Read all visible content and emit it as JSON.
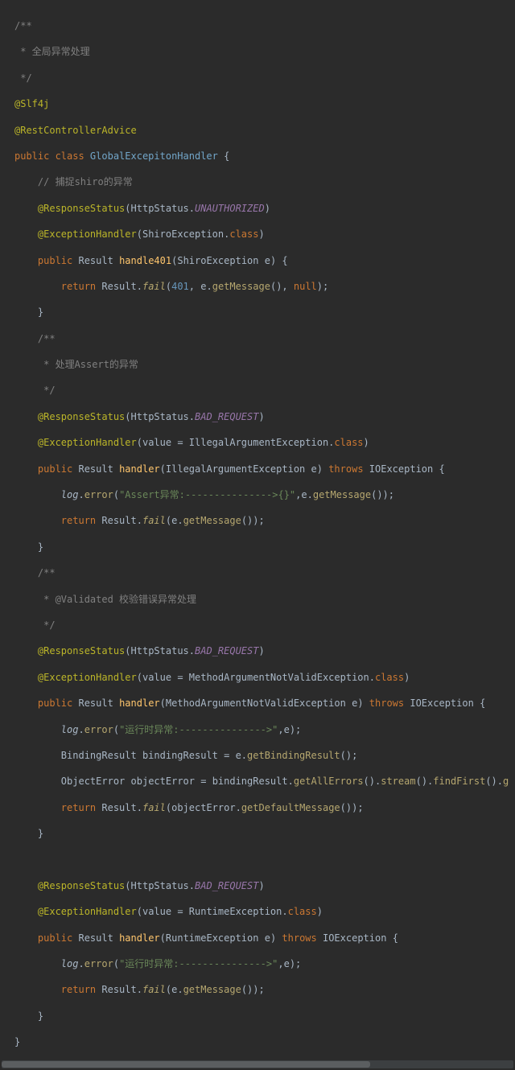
{
  "lines": [
    [
      {
        "cls": "c-comment",
        "t": "/**"
      }
    ],
    [
      {
        "cls": "c-comment",
        "t": " * 全局异常处理"
      }
    ],
    [
      {
        "cls": "c-comment",
        "t": " */"
      }
    ],
    [
      {
        "cls": "c-annotation",
        "t": "@Slf4j"
      }
    ],
    [
      {
        "cls": "c-annotation",
        "t": "@RestControllerAdvice"
      }
    ],
    [
      {
        "cls": "c-keyword",
        "t": "public class "
      },
      {
        "cls": "c-classname",
        "t": "GlobalExcepitonHandler"
      },
      {
        "cls": "c-punct",
        "t": " {"
      }
    ],
    [
      {
        "cls": "",
        "t": "    "
      },
      {
        "cls": "c-comment",
        "t": "// 捕捉shiro的异常"
      }
    ],
    [
      {
        "cls": "",
        "t": "    "
      },
      {
        "cls": "c-annotation",
        "t": "@ResponseStatus"
      },
      {
        "cls": "c-punct",
        "t": "("
      },
      {
        "cls": "c-classuse",
        "t": "HttpStatus"
      },
      {
        "cls": "c-punct",
        "t": "."
      },
      {
        "cls": "c-const",
        "t": "UNAUTHORIZED"
      },
      {
        "cls": "c-punct",
        "t": ")"
      }
    ],
    [
      {
        "cls": "",
        "t": "    "
      },
      {
        "cls": "c-annotation",
        "t": "@ExceptionHandler"
      },
      {
        "cls": "c-punct",
        "t": "("
      },
      {
        "cls": "c-classuse",
        "t": "ShiroException"
      },
      {
        "cls": "c-punct",
        "t": "."
      },
      {
        "cls": "c-keyword",
        "t": "class"
      },
      {
        "cls": "c-punct",
        "t": ")"
      }
    ],
    [
      {
        "cls": "",
        "t": "    "
      },
      {
        "cls": "c-keyword",
        "t": "public "
      },
      {
        "cls": "c-classuse",
        "t": "Result"
      },
      {
        "cls": "",
        "t": " "
      },
      {
        "cls": "c-method",
        "t": "handle401"
      },
      {
        "cls": "c-punct",
        "t": "("
      },
      {
        "cls": "c-classuse",
        "t": "ShiroException"
      },
      {
        "cls": "",
        "t": " "
      },
      {
        "cls": "c-param",
        "t": "e"
      },
      {
        "cls": "c-punct",
        "t": ") {"
      }
    ],
    [
      {
        "cls": "",
        "t": "        "
      },
      {
        "cls": "c-keyword",
        "t": "return "
      },
      {
        "cls": "c-classuse",
        "t": "Result"
      },
      {
        "cls": "c-punct",
        "t": "."
      },
      {
        "cls": "c-methoduse c-static",
        "t": "fail"
      },
      {
        "cls": "c-punct",
        "t": "("
      },
      {
        "cls": "c-number",
        "t": "401"
      },
      {
        "cls": "c-punct",
        "t": ", "
      },
      {
        "cls": "c-var",
        "t": "e"
      },
      {
        "cls": "c-punct",
        "t": "."
      },
      {
        "cls": "c-methoduse",
        "t": "getMessage"
      },
      {
        "cls": "c-punct",
        "t": "(), "
      },
      {
        "cls": "c-keyword",
        "t": "null"
      },
      {
        "cls": "c-punct",
        "t": ");"
      }
    ],
    [
      {
        "cls": "",
        "t": "    "
      },
      {
        "cls": "c-punct",
        "t": "}"
      }
    ],
    [
      {
        "cls": "",
        "t": "    "
      },
      {
        "cls": "c-comment",
        "t": "/**"
      }
    ],
    [
      {
        "cls": "",
        "t": "     "
      },
      {
        "cls": "c-comment",
        "t": "* 处理Assert的异常"
      }
    ],
    [
      {
        "cls": "",
        "t": "     "
      },
      {
        "cls": "c-comment",
        "t": "*/"
      }
    ],
    [
      {
        "cls": "",
        "t": "    "
      },
      {
        "cls": "c-annotation",
        "t": "@ResponseStatus"
      },
      {
        "cls": "c-punct",
        "t": "("
      },
      {
        "cls": "c-classuse",
        "t": "HttpStatus"
      },
      {
        "cls": "c-punct",
        "t": "."
      },
      {
        "cls": "c-const",
        "t": "BAD_REQUEST"
      },
      {
        "cls": "c-punct",
        "t": ")"
      }
    ],
    [
      {
        "cls": "",
        "t": "    "
      },
      {
        "cls": "c-annotation",
        "t": "@ExceptionHandler"
      },
      {
        "cls": "c-punct",
        "t": "("
      },
      {
        "cls": "c-var",
        "t": "value"
      },
      {
        "cls": "c-punct",
        "t": " = "
      },
      {
        "cls": "c-classuse",
        "t": "IllegalArgumentException"
      },
      {
        "cls": "c-punct",
        "t": "."
      },
      {
        "cls": "c-keyword",
        "t": "class"
      },
      {
        "cls": "c-punct",
        "t": ")"
      }
    ],
    [
      {
        "cls": "",
        "t": "    "
      },
      {
        "cls": "c-keyword",
        "t": "public "
      },
      {
        "cls": "c-classuse",
        "t": "Result"
      },
      {
        "cls": "",
        "t": " "
      },
      {
        "cls": "c-method",
        "t": "handler"
      },
      {
        "cls": "c-punct",
        "t": "("
      },
      {
        "cls": "c-classuse",
        "t": "IllegalArgumentException"
      },
      {
        "cls": "",
        "t": " "
      },
      {
        "cls": "c-param",
        "t": "e"
      },
      {
        "cls": "c-punct",
        "t": ") "
      },
      {
        "cls": "c-keyword",
        "t": "throws "
      },
      {
        "cls": "c-classuse",
        "t": "IOException"
      },
      {
        "cls": "c-punct",
        "t": " {"
      }
    ],
    [
      {
        "cls": "",
        "t": "        "
      },
      {
        "cls": "c-var c-static",
        "t": "log"
      },
      {
        "cls": "c-punct",
        "t": "."
      },
      {
        "cls": "c-methoduse",
        "t": "error"
      },
      {
        "cls": "c-punct",
        "t": "("
      },
      {
        "cls": "c-string",
        "t": "\"Assert异常:--------------->{}\""
      },
      {
        "cls": "c-punct",
        "t": ","
      },
      {
        "cls": "c-var",
        "t": "e"
      },
      {
        "cls": "c-punct",
        "t": "."
      },
      {
        "cls": "c-methoduse",
        "t": "getMessage"
      },
      {
        "cls": "c-punct",
        "t": "());"
      }
    ],
    [
      {
        "cls": "",
        "t": "        "
      },
      {
        "cls": "c-keyword",
        "t": "return "
      },
      {
        "cls": "c-classuse",
        "t": "Result"
      },
      {
        "cls": "c-punct",
        "t": "."
      },
      {
        "cls": "c-methoduse c-static",
        "t": "fail"
      },
      {
        "cls": "c-punct",
        "t": "("
      },
      {
        "cls": "c-var",
        "t": "e"
      },
      {
        "cls": "c-punct",
        "t": "."
      },
      {
        "cls": "c-methoduse",
        "t": "getMessage"
      },
      {
        "cls": "c-punct",
        "t": "());"
      }
    ],
    [
      {
        "cls": "",
        "t": "    "
      },
      {
        "cls": "c-punct",
        "t": "}"
      }
    ],
    [
      {
        "cls": "",
        "t": "    "
      },
      {
        "cls": "c-comment",
        "t": "/**"
      }
    ],
    [
      {
        "cls": "",
        "t": "     "
      },
      {
        "cls": "c-comment",
        "t": "* @Validated 校验错误异常处理"
      }
    ],
    [
      {
        "cls": "",
        "t": "     "
      },
      {
        "cls": "c-comment",
        "t": "*/"
      }
    ],
    [
      {
        "cls": "",
        "t": "    "
      },
      {
        "cls": "c-annotation",
        "t": "@ResponseStatus"
      },
      {
        "cls": "c-punct",
        "t": "("
      },
      {
        "cls": "c-classuse",
        "t": "HttpStatus"
      },
      {
        "cls": "c-punct",
        "t": "."
      },
      {
        "cls": "c-const",
        "t": "BAD_REQUEST"
      },
      {
        "cls": "c-punct",
        "t": ")"
      }
    ],
    [
      {
        "cls": "",
        "t": "    "
      },
      {
        "cls": "c-annotation",
        "t": "@ExceptionHandler"
      },
      {
        "cls": "c-punct",
        "t": "("
      },
      {
        "cls": "c-var",
        "t": "value"
      },
      {
        "cls": "c-punct",
        "t": " = "
      },
      {
        "cls": "c-classuse",
        "t": "MethodArgumentNotValidException"
      },
      {
        "cls": "c-punct",
        "t": "."
      },
      {
        "cls": "c-keyword",
        "t": "class"
      },
      {
        "cls": "c-punct",
        "t": ")"
      }
    ],
    [
      {
        "cls": "",
        "t": "    "
      },
      {
        "cls": "c-keyword",
        "t": "public "
      },
      {
        "cls": "c-classuse",
        "t": "Result"
      },
      {
        "cls": "",
        "t": " "
      },
      {
        "cls": "c-method",
        "t": "handler"
      },
      {
        "cls": "c-punct",
        "t": "("
      },
      {
        "cls": "c-classuse",
        "t": "MethodArgumentNotValidException"
      },
      {
        "cls": "",
        "t": " "
      },
      {
        "cls": "c-param",
        "t": "e"
      },
      {
        "cls": "c-punct",
        "t": ") "
      },
      {
        "cls": "c-keyword",
        "t": "throws "
      },
      {
        "cls": "c-classuse",
        "t": "IOException"
      },
      {
        "cls": "c-punct",
        "t": " {"
      }
    ],
    [
      {
        "cls": "",
        "t": "        "
      },
      {
        "cls": "c-var c-static",
        "t": "log"
      },
      {
        "cls": "c-punct",
        "t": "."
      },
      {
        "cls": "c-methoduse",
        "t": "error"
      },
      {
        "cls": "c-punct",
        "t": "("
      },
      {
        "cls": "c-string",
        "t": "\"运行时异常:--------------->\""
      },
      {
        "cls": "c-punct",
        "t": ","
      },
      {
        "cls": "c-var",
        "t": "e"
      },
      {
        "cls": "c-punct",
        "t": ");"
      }
    ],
    [
      {
        "cls": "",
        "t": "        "
      },
      {
        "cls": "c-classuse",
        "t": "BindingResult"
      },
      {
        "cls": "",
        "t": " "
      },
      {
        "cls": "c-var",
        "t": "bindingResult"
      },
      {
        "cls": "c-punct",
        "t": " = "
      },
      {
        "cls": "c-var",
        "t": "e"
      },
      {
        "cls": "c-punct",
        "t": "."
      },
      {
        "cls": "c-methoduse",
        "t": "getBindingResult"
      },
      {
        "cls": "c-punct",
        "t": "();"
      }
    ],
    [
      {
        "cls": "",
        "t": "        "
      },
      {
        "cls": "c-classuse",
        "t": "ObjectError"
      },
      {
        "cls": "",
        "t": " "
      },
      {
        "cls": "c-var",
        "t": "objectError"
      },
      {
        "cls": "c-punct",
        "t": " = "
      },
      {
        "cls": "c-var",
        "t": "bindingResult"
      },
      {
        "cls": "c-punct",
        "t": "."
      },
      {
        "cls": "c-methoduse",
        "t": "getAllErrors"
      },
      {
        "cls": "c-punct",
        "t": "()."
      },
      {
        "cls": "c-methoduse",
        "t": "stream"
      },
      {
        "cls": "c-punct",
        "t": "()."
      },
      {
        "cls": "c-methoduse",
        "t": "findFirst"
      },
      {
        "cls": "c-punct",
        "t": "()."
      },
      {
        "cls": "c-methoduse",
        "t": "g"
      }
    ],
    [
      {
        "cls": "",
        "t": "        "
      },
      {
        "cls": "c-keyword",
        "t": "return "
      },
      {
        "cls": "c-classuse",
        "t": "Result"
      },
      {
        "cls": "c-punct",
        "t": "."
      },
      {
        "cls": "c-methoduse c-static",
        "t": "fail"
      },
      {
        "cls": "c-punct",
        "t": "("
      },
      {
        "cls": "c-var",
        "t": "objectError"
      },
      {
        "cls": "c-punct",
        "t": "."
      },
      {
        "cls": "c-methoduse",
        "t": "getDefaultMessage"
      },
      {
        "cls": "c-punct",
        "t": "());"
      }
    ],
    [
      {
        "cls": "",
        "t": "    "
      },
      {
        "cls": "c-punct",
        "t": "}"
      }
    ],
    [
      {
        "cls": "",
        "t": " "
      }
    ],
    [
      {
        "cls": "",
        "t": "    "
      },
      {
        "cls": "c-annotation",
        "t": "@ResponseStatus"
      },
      {
        "cls": "c-punct",
        "t": "("
      },
      {
        "cls": "c-classuse",
        "t": "HttpStatus"
      },
      {
        "cls": "c-punct",
        "t": "."
      },
      {
        "cls": "c-const",
        "t": "BAD_REQUEST"
      },
      {
        "cls": "c-punct",
        "t": ")"
      }
    ],
    [
      {
        "cls": "",
        "t": "    "
      },
      {
        "cls": "c-annotation",
        "t": "@ExceptionHandler"
      },
      {
        "cls": "c-punct",
        "t": "("
      },
      {
        "cls": "c-var",
        "t": "value"
      },
      {
        "cls": "c-punct",
        "t": " = "
      },
      {
        "cls": "c-classuse",
        "t": "RuntimeException"
      },
      {
        "cls": "c-punct",
        "t": "."
      },
      {
        "cls": "c-keyword",
        "t": "class"
      },
      {
        "cls": "c-punct",
        "t": ")"
      }
    ],
    [
      {
        "cls": "",
        "t": "    "
      },
      {
        "cls": "c-keyword",
        "t": "public "
      },
      {
        "cls": "c-classuse",
        "t": "Result"
      },
      {
        "cls": "",
        "t": " "
      },
      {
        "cls": "c-method",
        "t": "handler"
      },
      {
        "cls": "c-punct",
        "t": "("
      },
      {
        "cls": "c-classuse",
        "t": "RuntimeException"
      },
      {
        "cls": "",
        "t": " "
      },
      {
        "cls": "c-param",
        "t": "e"
      },
      {
        "cls": "c-punct",
        "t": ") "
      },
      {
        "cls": "c-keyword",
        "t": "throws "
      },
      {
        "cls": "c-classuse",
        "t": "IOException"
      },
      {
        "cls": "c-punct",
        "t": " {"
      }
    ],
    [
      {
        "cls": "",
        "t": "        "
      },
      {
        "cls": "c-var c-static",
        "t": "log"
      },
      {
        "cls": "c-punct",
        "t": "."
      },
      {
        "cls": "c-methoduse",
        "t": "error"
      },
      {
        "cls": "c-punct",
        "t": "("
      },
      {
        "cls": "c-string",
        "t": "\"运行时异常:--------------->\""
      },
      {
        "cls": "c-punct",
        "t": ","
      },
      {
        "cls": "c-var",
        "t": "e"
      },
      {
        "cls": "c-punct",
        "t": ");"
      }
    ],
    [
      {
        "cls": "",
        "t": "        "
      },
      {
        "cls": "c-keyword",
        "t": "return "
      },
      {
        "cls": "c-classuse",
        "t": "Result"
      },
      {
        "cls": "c-punct",
        "t": "."
      },
      {
        "cls": "c-methoduse c-static",
        "t": "fail"
      },
      {
        "cls": "c-punct",
        "t": "("
      },
      {
        "cls": "c-var",
        "t": "e"
      },
      {
        "cls": "c-punct",
        "t": "."
      },
      {
        "cls": "c-methoduse",
        "t": "getMessage"
      },
      {
        "cls": "c-punct",
        "t": "());"
      }
    ],
    [
      {
        "cls": "",
        "t": "    "
      },
      {
        "cls": "c-punct",
        "t": "}"
      }
    ],
    [
      {
        "cls": "c-punct",
        "t": "}"
      }
    ]
  ]
}
